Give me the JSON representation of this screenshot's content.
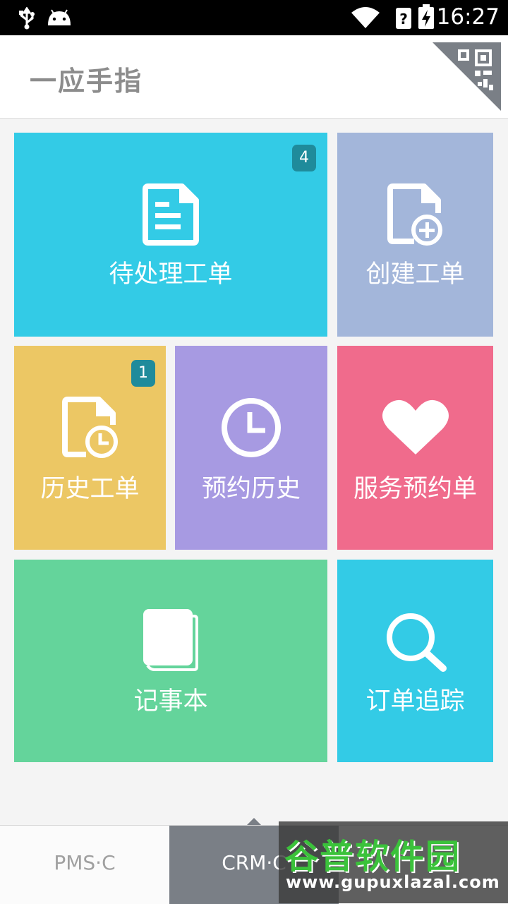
{
  "status_bar": {
    "time": "16:27"
  },
  "header": {
    "title": "一应手指"
  },
  "tiles": {
    "pending": {
      "label": "待处理工单",
      "badge": "4",
      "color": "#33cbe6"
    },
    "create": {
      "label": "创建工单",
      "color": "#a3b6da"
    },
    "history": {
      "label": "历史工单",
      "badge": "1",
      "color": "#ecc764"
    },
    "booking_history": {
      "label": "预约历史",
      "color": "#a79ae2"
    },
    "service_booking": {
      "label": "服务预约单",
      "color": "#f06b8c"
    },
    "notebook": {
      "label": "记事本",
      "color": "#64d49b"
    },
    "order_tracking": {
      "label": "订单追踪",
      "color": "#33cbe6"
    }
  },
  "bottom_tabs": [
    {
      "label": "PMS·C",
      "active": false
    },
    {
      "label": "CRM·C",
      "active": true
    }
  ],
  "watermark": {
    "title": "谷普软件园",
    "url": "www.gupuxlazal.com"
  }
}
